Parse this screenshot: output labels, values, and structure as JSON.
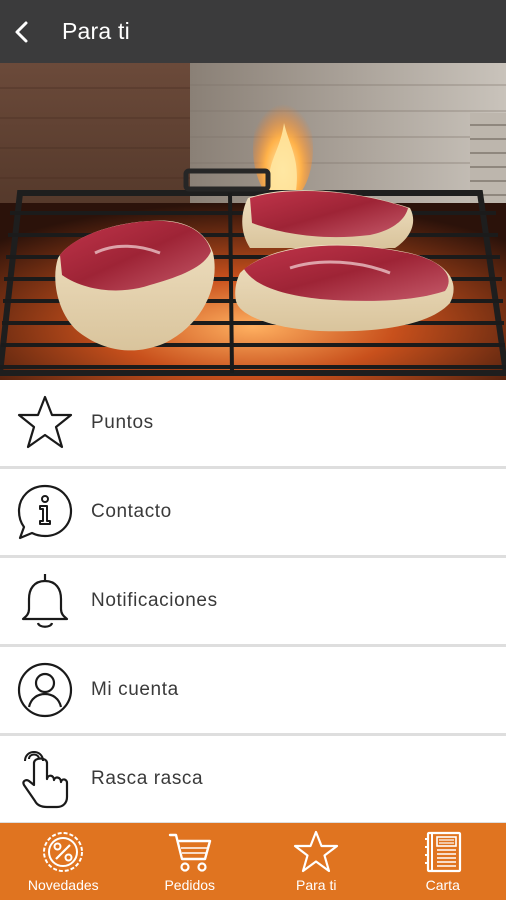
{
  "header": {
    "title": "Para ti",
    "back_icon": "chevron-left-icon"
  },
  "hero": {
    "description_icon": "grilled-meat-photo"
  },
  "menu": {
    "items": [
      {
        "label": "Puntos",
        "icon": "star-icon"
      },
      {
        "label": "Contacto",
        "icon": "info-bubble-icon"
      },
      {
        "label": "Notificaciones",
        "icon": "bell-icon"
      },
      {
        "label": "Mi cuenta",
        "icon": "user-circle-icon"
      },
      {
        "label": "Rasca rasca",
        "icon": "tap-hand-icon"
      }
    ]
  },
  "bottom_nav": {
    "items": [
      {
        "label": "Novedades",
        "icon": "percent-badge-icon"
      },
      {
        "label": "Pedidos",
        "icon": "cart-icon"
      },
      {
        "label": "Para ti",
        "icon": "star-icon"
      },
      {
        "label": "Carta",
        "icon": "menu-book-icon"
      }
    ]
  },
  "colors": {
    "header_bg": "#3b3b3c",
    "accent": "#e07420",
    "text": "#3a3a3a",
    "divider": "#dedede"
  }
}
